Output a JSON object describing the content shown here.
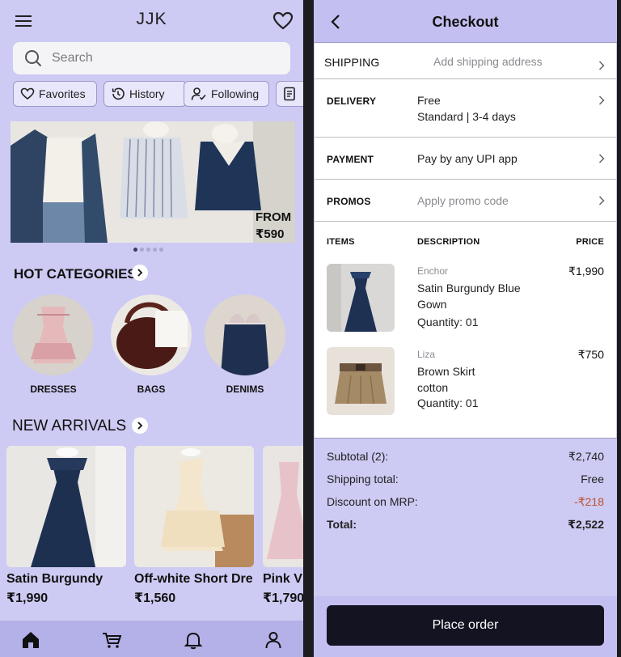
{
  "left": {
    "brand": "JJK",
    "search": {
      "placeholder": "Search"
    },
    "chips": [
      {
        "label": "Favorites",
        "icon": "heart-icon"
      },
      {
        "label": "History",
        "icon": "history-icon"
      },
      {
        "label": "Following",
        "icon": "following-icon"
      },
      {
        "label": "",
        "icon": "document-icon"
      }
    ],
    "hero": {
      "from": "FROM",
      "price": "₹590",
      "active_slide": 1,
      "slides": 5
    },
    "hot_categories": {
      "title": "HOT CATEGORIES",
      "items": [
        {
          "label": "DRESSES"
        },
        {
          "label": "BAGS"
        },
        {
          "label": "DENIMS"
        }
      ]
    },
    "new_arrivals": {
      "title": "NEW ARRIVALS",
      "items": [
        {
          "name": "Satin Burgundy",
          "price": "₹1,990"
        },
        {
          "name": "Off-white Short Dre",
          "price": "₹1,560"
        },
        {
          "name": "Pink V",
          "price": "₹1,790"
        }
      ]
    },
    "nav": [
      "home-icon",
      "cart-icon",
      "bell-icon",
      "profile-icon"
    ]
  },
  "checkout": {
    "title": "Checkout",
    "shipping": {
      "label": "SHIPPING",
      "value": "Add shipping address"
    },
    "delivery": {
      "label": "DELIVERY",
      "line1": "Free",
      "line2": "Standard | 3-4 days"
    },
    "payment": {
      "label": "PAYMENT",
      "value": "Pay by any UPI app"
    },
    "promos": {
      "label": "PROMOS",
      "value": "Apply promo code"
    },
    "items_header": {
      "items": "ITEMS",
      "description": "DESCRIPTION",
      "price": "PRICE"
    },
    "items": [
      {
        "brand": "Enchor",
        "name_line1": "Satin Burgundy Blue",
        "name_line2": "Gown",
        "quantity": "Quantity: 01",
        "price": "₹1,990"
      },
      {
        "brand": "Liza",
        "name_line1": "Brown Skirt",
        "name_line2": "cotton",
        "quantity": "Quantity: 01",
        "price": "₹750"
      }
    ],
    "summary": {
      "subtotal_label": "Subtotal (2):",
      "subtotal": "₹2,740",
      "shipping_label": "Shipping total:",
      "shipping": "Free",
      "discount_label": "Discount on MRP:",
      "discount": "-₹218",
      "total_label": "Total:",
      "total": "₹2,522"
    },
    "place_order": "Place order"
  }
}
